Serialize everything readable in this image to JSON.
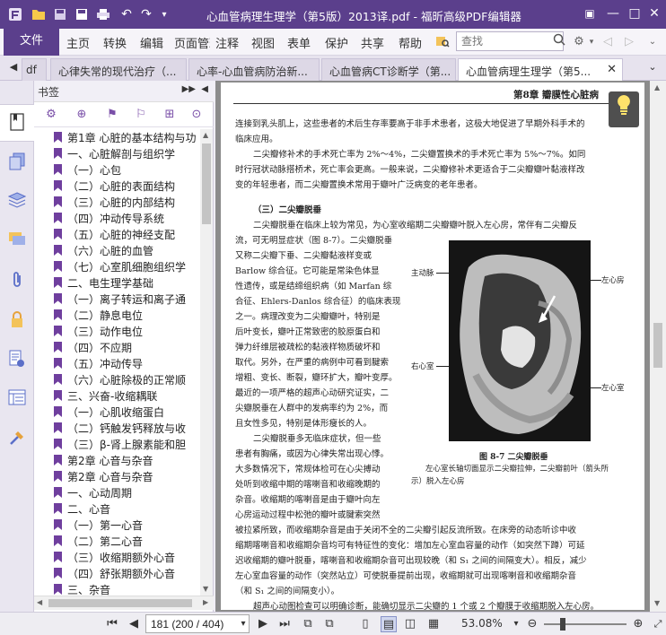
{
  "titlebar": {
    "title": "心血管病理生理学（第5版）2013译.pdf - 福昕高级PDF编辑器"
  },
  "menubar": {
    "file": "文件",
    "items": [
      "主页",
      "转换",
      "编辑",
      "页面管理",
      "注释",
      "视图",
      "表单",
      "保护",
      "共享",
      "帮助"
    ],
    "search_placeholder": "查找"
  },
  "tabs": [
    {
      "label": "df"
    },
    {
      "label": "心律失常的现代治疗（..."
    },
    {
      "label": "心率-心血管病防治新..."
    },
    {
      "label": "心血管病CT诊断学（第..."
    },
    {
      "label": "心血管病理生理学（第5..."
    }
  ],
  "bookmarks": {
    "header": "书签",
    "items": [
      {
        "label": "第1章  心脏的基本结构与功"
      },
      {
        "label": "一、心脏解剖与组织学"
      },
      {
        "label": "（一）心包"
      },
      {
        "label": "（二）心脏的表面结构"
      },
      {
        "label": "（三）心脏的内部结构"
      },
      {
        "label": "（四）冲动传导系统"
      },
      {
        "label": "（五）心脏的神经支配"
      },
      {
        "label": "（六）心脏的血管"
      },
      {
        "label": "（七）心室肌细胞组织学"
      },
      {
        "label": "二、电生理学基础"
      },
      {
        "label": "（一）离子转运和离子通"
      },
      {
        "label": "（二）静息电位"
      },
      {
        "label": "（三）动作电位"
      },
      {
        "label": "（四）不应期"
      },
      {
        "label": "（五）冲动传导"
      },
      {
        "label": "（六）心脏除极的正常顺"
      },
      {
        "label": "三、兴奋-收缩耦联"
      },
      {
        "label": "（一）心肌收缩蛋白"
      },
      {
        "label": "（二）钙触发钙释放与收"
      },
      {
        "label": "（三）β-肾上腺素能和胆"
      },
      {
        "label": "第2章  心音与杂音"
      },
      {
        "label": "第2章  心音与杂音"
      },
      {
        "label": "一、心动周期"
      },
      {
        "label": "二、心音"
      },
      {
        "label": "（一）第一心音"
      },
      {
        "label": "（二）第二心音"
      },
      {
        "label": "（三）收缩期额外心音"
      },
      {
        "label": "（四）舒张期额外心音"
      },
      {
        "label": "三、杂音"
      }
    ]
  },
  "document": {
    "header": "第8章  瓣膜性心脏病",
    "paragraphs": [
      "连接到乳头肌上，这些患者的术后生存率要高于非手术患者，这极大地促进了早期外科手术的",
      "临床应用。",
      "二尖瓣修补术的手术死亡率为 2%～4%，二尖瓣置换术的手术死亡率为 5%～7%。如同",
      "时行冠状动脉搭桥术，死亡率会更高。一般来说，二尖瓣修补术更适合于二尖瓣瓣叶黏液样改",
      "变的年轻患者，而二尖瓣置换术常用于瓣叶广泛病变的老年患者。",
      "（三）二尖瓣脱垂",
      "二尖瓣脱垂在临床上较为常见，为心室收缩期二尖瓣瓣叶脱入左心房，常伴有二尖瓣反",
      "流，可无明显症状（图 8-7）。二尖瓣脱垂",
      "又称二尖瓣下垂、二尖瓣黏液样变或",
      "Barlow 综合征。它可能是常染色体显",
      "性遗传，或是结缔组织病（如 Marfan 综",
      "合征、Ehlers-Danlos 综合征）的临床表现",
      "之一。病理改变为二尖瓣瓣叶，特别是",
      "后叶变长，瓣叶正常致密的胶原蛋白和",
      "弹力纤维层被疏松的黏液样物质破坏和",
      "取代。另外，在严重的病例中可看到腱索",
      "增粗、变长、断裂，瓣环扩大，瓣叶变厚。",
      "最近的一项严格的超声心动研究证实，二",
      "尖瓣脱垂在人群中的发病率约为 2%，而",
      "且女性多见，特别是体形瘦长的人。",
      "二尖瓣脱垂多无临床症状，但一些",
      "患者有胸痛，或因为心律失常出现心悸。",
      "大多数情况下，常规体检可在心尖搏动",
      "处听到收缩中期的喀喇音和收缩晚期的",
      "杂音。收缩期的喀喇音是由于瓣叶向左",
      "心房运动过程中松弛的瓣叶或腱索突然",
      "被拉紧所致，而收缩期杂音是由于关闭不全的二尖瓣引起反流所致。在床旁的动态听诊中收",
      "缩期喀喇音和收缩期杂音均可有特征性的变化：增加左心室血容量的动作（如突然下蹲）可延",
      "迟收缩期的瓣叶脱垂，喀喇音和收缩期杂音可出现较晚（和 S₁ 之间的间隔变大）。相反，减少",
      "左心室血容量的动作（突然站立）可使脱垂提前出现，收缩期就可出现喀喇音和收缩期杂音",
      "（和 S₁ 之间的间隔变小）。",
      "超声心动图检查可以明确诊断，能确切显示二尖瓣的 1 个或 2 个瓣膜于收缩期脱入左心房。"
    ],
    "figure": {
      "label_left_top": "主动脉",
      "label_right_top": "左心房",
      "label_left_mid": "右心室",
      "label_right_bottom": "左心室",
      "caption_title": "图 8-7   二尖瓣脱垂",
      "caption_line1": "左心室长轴切面显示二尖瓣拉伸，二尖瓣前叶（箭头所",
      "caption_line2": "示）脱入左心房"
    }
  },
  "statusbar": {
    "page_value": "181 (200 / 404)",
    "zoom": "53.08%"
  }
}
